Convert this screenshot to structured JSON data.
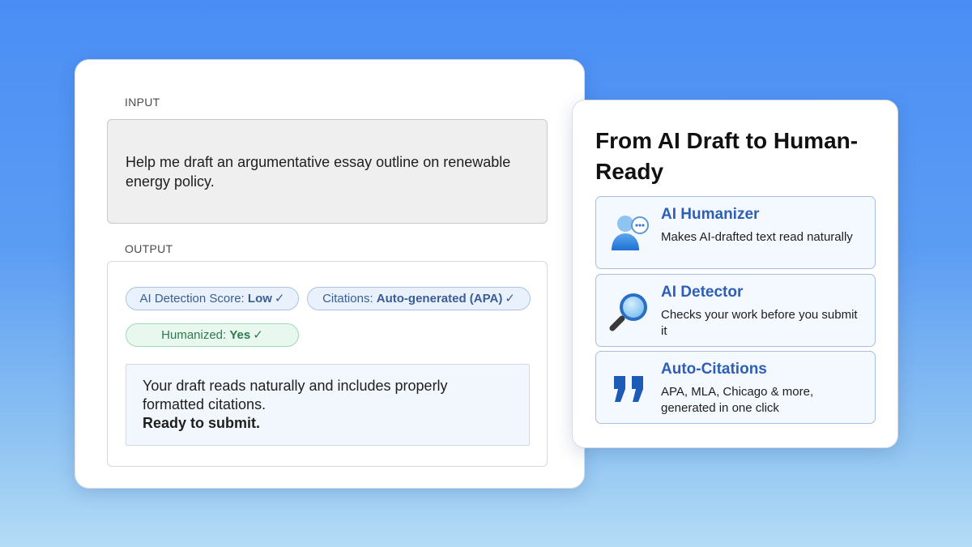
{
  "input": {
    "label": "INPUT",
    "text": "Help me draft an argumentative essay outline on renewable energy policy."
  },
  "output": {
    "label": "OUTPUT",
    "badges": [
      {
        "prefix": "AI Detection Score: ",
        "value": "Low",
        "check": "✓"
      },
      {
        "prefix": "Citations: ",
        "value": "Auto-generated (APA)",
        "check": "✓"
      },
      {
        "prefix": "Humanized: ",
        "value": "Yes",
        "check": "✓"
      }
    ],
    "result_text": "Your draft reads naturally and includes properly formatted citations.",
    "result_strong": "Ready to submit."
  },
  "panel": {
    "title": "From AI Draft to Human-Ready",
    "features": [
      {
        "title": "AI Humanizer",
        "desc": "Makes AI-drafted text read naturally",
        "icon": "user-chat-icon"
      },
      {
        "title": "AI Detector",
        "desc": "Checks your work before you submit it",
        "icon": "magnifier-icon"
      },
      {
        "title": "Auto-Citations",
        "desc": "APA, MLA, Chicago & more, generated in one click",
        "icon": "quote-icon"
      }
    ]
  },
  "colors": {
    "background_top": "#4a8ef5",
    "background_bottom": "#b4dcf7",
    "accent_blue": "#2d5fb6",
    "badge_green": "#2f7a4c"
  }
}
